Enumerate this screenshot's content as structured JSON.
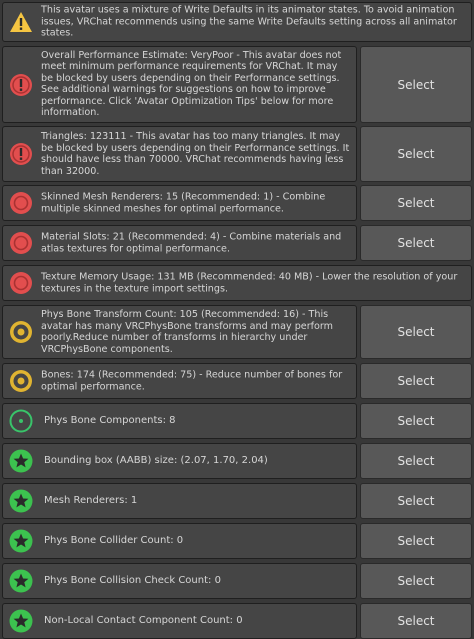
{
  "button_label": "Select",
  "colors": {
    "error": "#e24e4e",
    "warning": "#e0b431",
    "info_ring": "#39c46a",
    "good": "#3cc24f",
    "warn_triangle": "#f5c542"
  },
  "items": [
    {
      "text": "This avatar uses a mixture of Write Defaults in its animator states. To avoid animation issues, VRChat recommends using the same Write Defaults setting across all animator states.",
      "icon": "warning-triangle-icon",
      "has_button": false
    },
    {
      "text": "Overall Performance Estimate: VeryPoor - This avatar does not meet minimum performance requirements for VRChat. It may be blocked by users depending on their Performance settings. See additional warnings for suggestions on how to improve performance. Click 'Avatar Optimization Tips' below for more information.",
      "icon": "error-exclamation-icon",
      "has_button": true
    },
    {
      "text": "Triangles: 123111 - This avatar has too many triangles. It may be blocked by users depending on their Performance settings. It should have less than 70000. VRChat recommends having less than 32000.",
      "icon": "error-exclamation-icon",
      "has_button": true
    },
    {
      "text": "Skinned Mesh Renderers: 15 (Recommended: 1) - Combine multiple skinned meshes for optimal performance.",
      "icon": "error-circle-icon",
      "has_button": true
    },
    {
      "text": "Material Slots: 21 (Recommended: 4) - Combine materials and atlas textures for optimal performance.",
      "icon": "error-circle-icon",
      "has_button": true
    },
    {
      "text": "Texture Memory Usage: 131 MB (Recommended: 40 MB) - Lower the resolution of your textures in the texture import settings.",
      "icon": "error-circle-icon",
      "has_button": false
    },
    {
      "text": "Phys Bone Transform Count: 105 (Recommended: 16) - This avatar has many VRCPhysBone transforms and may perform poorly.Reduce number of transforms in hierarchy under VRCPhysBone components.",
      "icon": "warning-ring-icon",
      "has_button": true
    },
    {
      "text": "Bones: 174 (Recommended: 75) - Reduce number of bones for optimal performance.",
      "icon": "warning-ring-icon",
      "has_button": true
    },
    {
      "text": "Phys Bone Components: 8",
      "icon": "info-dot-icon",
      "has_button": true
    },
    {
      "text": "Bounding box (AABB) size: (2.07, 1.70, 2.04)",
      "icon": "good-star-icon",
      "has_button": true
    },
    {
      "text": "Mesh Renderers: 1",
      "icon": "good-star-icon",
      "has_button": true
    },
    {
      "text": "Phys Bone Collider Count: 0",
      "icon": "good-star-icon",
      "has_button": true
    },
    {
      "text": "Phys Bone Collision Check Count: 0",
      "icon": "good-star-icon",
      "has_button": true
    },
    {
      "text": "Non-Local Contact Component Count: 0",
      "icon": "good-star-icon",
      "has_button": true
    }
  ]
}
